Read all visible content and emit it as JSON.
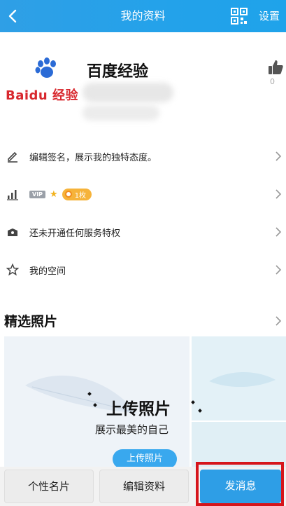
{
  "header": {
    "title": "我的资料",
    "settings_label": "设置",
    "bg_color": "#23a2ea"
  },
  "profile": {
    "name": "百度经验",
    "avatar_brand": "Baidu 经验",
    "like_count": "0"
  },
  "list": {
    "signature": "编辑签名，展示我的独特态度。",
    "vip_badge": "VIP",
    "coins": "1枚",
    "privilege": "还未开通任何服务特权",
    "space": "我的空间"
  },
  "photos": {
    "section_title": "精选照片",
    "upload_title": "上传照片",
    "upload_subtitle": "展示最美的自己",
    "upload_button": "上传照片"
  },
  "bottom": {
    "card_label": "个性名片",
    "edit_label": "编辑资料",
    "message_label": "发消息",
    "accent_color": "#2e9ee6",
    "highlight_color": "#d6151b"
  }
}
